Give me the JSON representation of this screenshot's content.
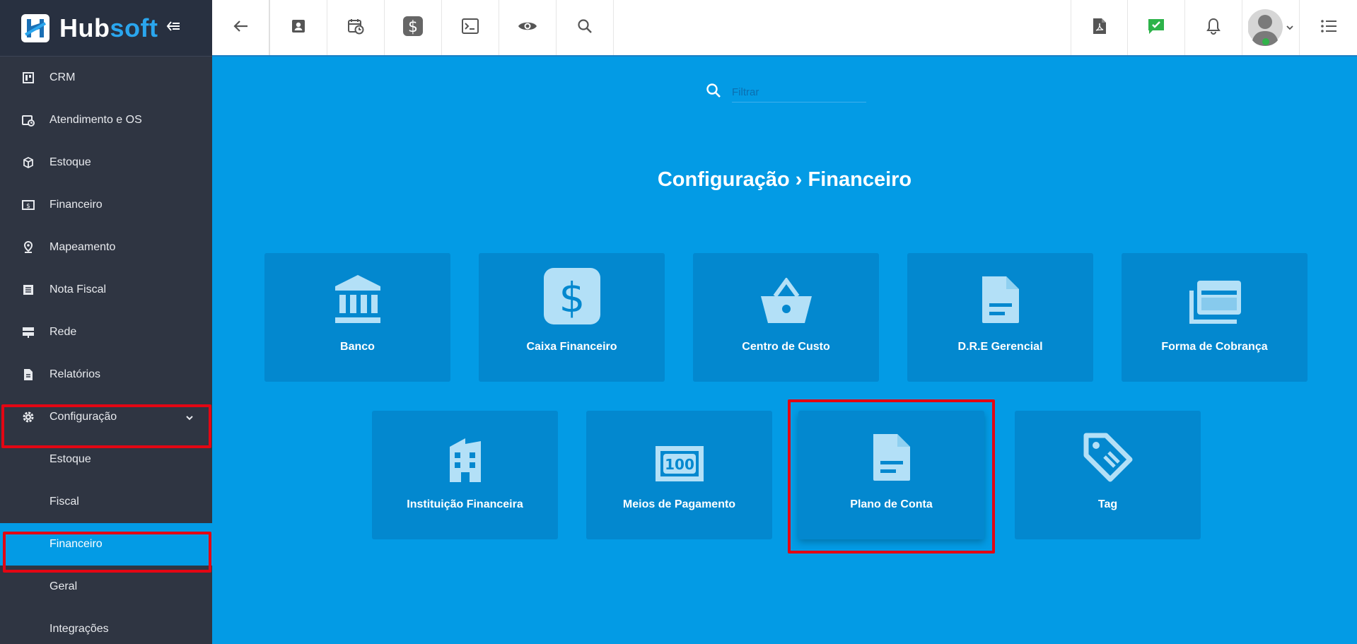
{
  "brand": {
    "name_part1": "Hub",
    "name_part2": "soft"
  },
  "sidebar": {
    "items": [
      {
        "label": "CRM",
        "icon": "board-icon"
      },
      {
        "label": "Atendimento e OS",
        "icon": "calendar-clock-icon"
      },
      {
        "label": "Estoque",
        "icon": "cube-icon"
      },
      {
        "label": "Financeiro",
        "icon": "money-icon"
      },
      {
        "label": "Mapeamento",
        "icon": "map-pin-icon"
      },
      {
        "label": "Nota Fiscal",
        "icon": "list-doc-icon"
      },
      {
        "label": "Rede",
        "icon": "server-icon"
      },
      {
        "label": "Relatórios",
        "icon": "file-icon"
      },
      {
        "label": "Configuração",
        "icon": "gear-icon"
      }
    ],
    "subitems": [
      {
        "label": "Estoque"
      },
      {
        "label": "Fiscal"
      },
      {
        "label": "Financeiro"
      },
      {
        "label": "Geral"
      },
      {
        "label": "Integrações"
      }
    ]
  },
  "toolbar": {
    "icons": [
      "back-arrow-icon",
      "contact-card-icon",
      "calendar-clock-icon",
      "dollar-icon",
      "terminal-icon",
      "eye-icon",
      "search-icon"
    ],
    "right_icons": [
      "pdf-icon",
      "chat-check-icon",
      "bell-icon",
      "avatar",
      "list-menu-icon"
    ]
  },
  "filter": {
    "placeholder": "Filtrar"
  },
  "page": {
    "title": "Configuração › Financeiro"
  },
  "tiles": [
    {
      "label": "Banco",
      "icon": "bank-icon"
    },
    {
      "label": "Caixa Financeiro",
      "icon": "dollar-box-icon"
    },
    {
      "label": "Centro de Custo",
      "icon": "basket-icon"
    },
    {
      "label": "D.R.E Gerencial",
      "icon": "document-icon"
    },
    {
      "label": "Forma de Cobrança",
      "icon": "cards-icon"
    },
    {
      "label": "Instituição Financeira",
      "icon": "building-icon"
    },
    {
      "label": "Meios de Pagamento",
      "icon": "banknote-icon"
    },
    {
      "label": "Plano de Conta",
      "icon": "document-icon"
    },
    {
      "label": "Tag",
      "icon": "tag-icon"
    }
  ],
  "banknote": {
    "value": "100"
  },
  "colors": {
    "sidebar": "#2f3542",
    "main": "#039be5",
    "tile": "#0388cf",
    "icon": "#b3e0f7",
    "highlight": "#e30613"
  }
}
